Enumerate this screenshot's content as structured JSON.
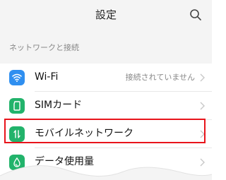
{
  "header": {
    "title": "設定",
    "search_icon": "search-icon"
  },
  "section": {
    "label": "ネットワークと接続"
  },
  "rows": [
    {
      "label": "Wi-Fi",
      "value": "接続されていません",
      "icon": "wifi-icon",
      "icon_color": "#2f8ff0"
    },
    {
      "label": "SIMカード",
      "value": "",
      "icon": "sim-card-icon",
      "icon_color": "#22b36b"
    },
    {
      "label": "モバイルネットワーク",
      "value": "",
      "icon": "mobile-data-icon",
      "icon_color": "#22b36b"
    },
    {
      "label": "データ使用量",
      "value": "",
      "icon": "data-usage-icon",
      "icon_color": "#22b36b"
    }
  ],
  "colors": {
    "highlight": "#e8141b",
    "header_bg": "#f4f4f4"
  }
}
